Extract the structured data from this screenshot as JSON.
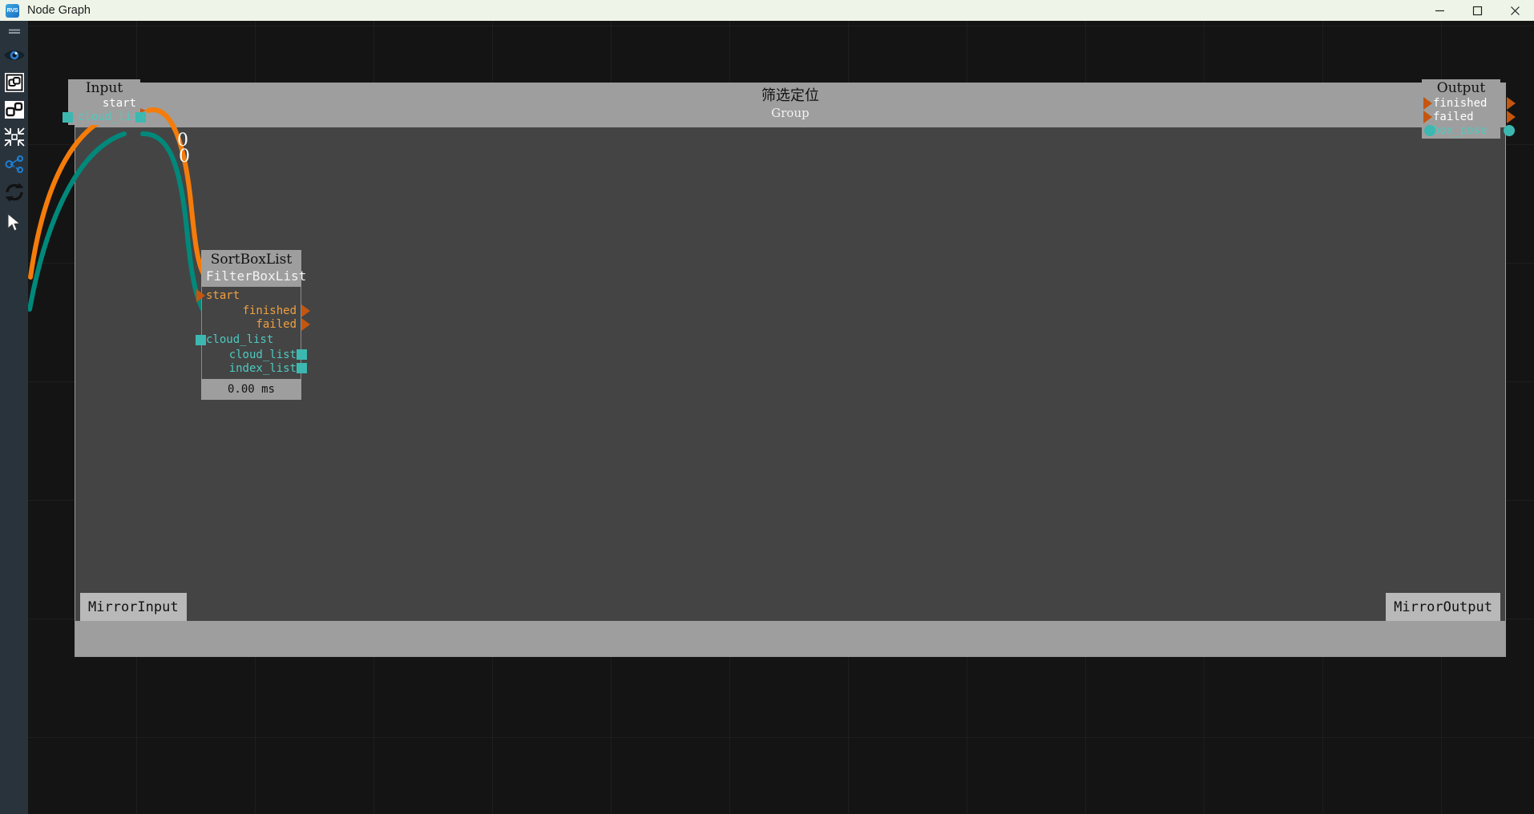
{
  "window": {
    "logo_text": "RVS",
    "title": "Node Graph",
    "controls": {
      "minimize": "minimize-icon",
      "maximize": "maximize-icon",
      "close": "close-icon"
    }
  },
  "sidebar": {
    "items": [
      {
        "name": "menu-handle-icon",
        "label": "Menu"
      },
      {
        "name": "eye-icon",
        "label": "Visibility"
      },
      {
        "name": "group-nodes-icon",
        "label": "Group Nodes"
      },
      {
        "name": "ungroup-nodes-icon",
        "label": "Ungroup Nodes"
      },
      {
        "name": "fit-to-view-icon",
        "label": "Fit To View"
      },
      {
        "name": "share-graph-icon",
        "label": "Share Graph"
      },
      {
        "name": "refresh-icon",
        "label": "Refresh"
      },
      {
        "name": "cursor-icon",
        "label": "Select Tool"
      }
    ]
  },
  "group": {
    "title": "筛选定位",
    "subtitle": "Group",
    "mirror_input": "MirrorInput",
    "mirror_output": "MirrorOutput"
  },
  "nodes": {
    "input": {
      "title": "Input",
      "exec_out": "start",
      "data_out": "cloud_list",
      "badges": [
        "0",
        "0"
      ]
    },
    "sortboxlist": {
      "title": "SortBoxList",
      "type": "FilterBoxList",
      "exec_in": "start",
      "exec_out_1": "finished",
      "exec_out_2": "failed",
      "data_in": "cloud_list",
      "data_out_1": "cloud_list",
      "data_out_2": "index_list",
      "runtime": "0.00 ms"
    },
    "output": {
      "title": "Output",
      "exec_in_1": "finished",
      "exec_in_2": "failed",
      "data_in": "box_pose"
    }
  },
  "colors": {
    "exec_port": "#c4560f",
    "data_port": "#3cb8b0",
    "exec_wire": "#f57c0a",
    "data_wire": "#00897b",
    "node_header": "#9e9e9e",
    "node_body": "#444444",
    "canvas_bg": "#141414",
    "sidebar_bg": "#29333c",
    "titlebar_bg": "#eef5e8"
  }
}
